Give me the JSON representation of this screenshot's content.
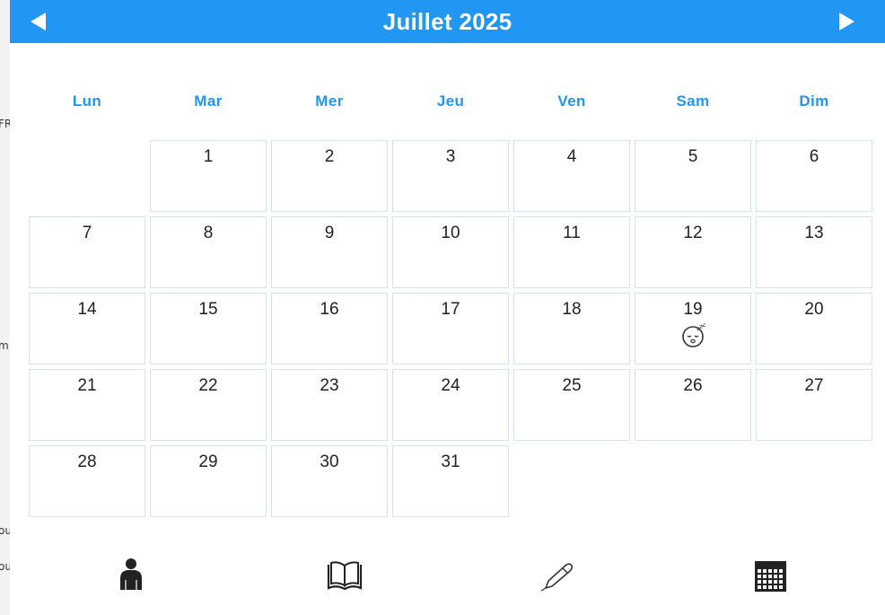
{
  "header": {
    "title": "Juillet 2025",
    "prev_icon": "left-triangle-icon",
    "next_icon": "right-triangle-icon",
    "color": "#2196F3"
  },
  "weekdays": [
    "Lun",
    "Mar",
    "Mer",
    "Jeu",
    "Ven",
    "Sam",
    "Dim"
  ],
  "month": {
    "days": [
      "1",
      "2",
      "3",
      "4",
      "5",
      "6",
      "7",
      "8",
      "9",
      "10",
      "11",
      "12",
      "13",
      "14",
      "15",
      "16",
      "17",
      "18",
      "19",
      "20",
      "21",
      "22",
      "23",
      "24",
      "25",
      "26",
      "27",
      "28",
      "29",
      "30",
      "31"
    ],
    "first_weekday_index": 1,
    "events": [
      {
        "day": "19",
        "icon": "sleeping-face-icon"
      }
    ]
  },
  "bottom_nav": [
    {
      "icon": "person-icon"
    },
    {
      "icon": "open-book-icon"
    },
    {
      "icon": "pen-icon"
    },
    {
      "icon": "calendar-icon"
    }
  ],
  "background_window": {
    "fragments": [
      "FR",
      "m",
      "ou",
      "ou"
    ]
  }
}
